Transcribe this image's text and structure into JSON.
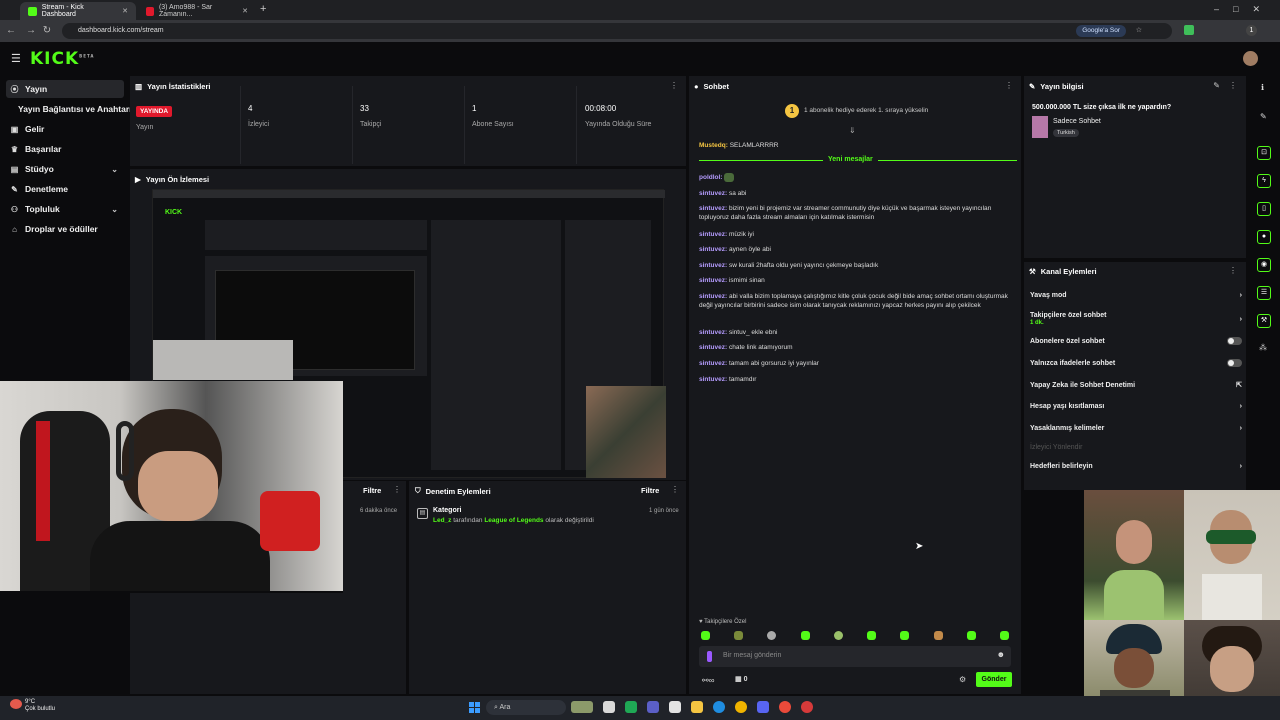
{
  "browser": {
    "tabs": [
      {
        "title": "Stream - Kick Dashboard",
        "active": true
      },
      {
        "title": "(3) Amo988 - Sar Zamanın...",
        "active": false
      }
    ],
    "url": "dashboard.kick.com/stream",
    "google_chip": "Google'a Sor"
  },
  "header": {
    "logo": "KICK",
    "logo_sup": "BETA"
  },
  "sidebar": {
    "items": [
      {
        "label": "Yayın",
        "icon": "broadcast-icon"
      },
      {
        "label": "Yayın Bağlantısı ve Anahtarı",
        "icon": ""
      },
      {
        "label": "Gelir",
        "icon": "wallet-icon"
      },
      {
        "label": "Başarılar",
        "icon": "trophy-icon"
      },
      {
        "label": "Stüdyo",
        "icon": "studio-icon"
      },
      {
        "label": "Denetleme",
        "icon": "wrench-icon"
      },
      {
        "label": "Topluluk",
        "icon": "users-icon"
      },
      {
        "label": "Droplar ve ödüller",
        "icon": "gift-icon"
      }
    ]
  },
  "stats": {
    "title": "Yayın İstatistikleri",
    "live_badge": "YAYINDA",
    "live_label": "Yayın",
    "viewers": "4",
    "viewers_label": "İzleyici",
    "followers": "33",
    "followers_label": "Takipçi",
    "subs": "1",
    "subs_label": "Abone Sayısı",
    "uptime": "00:08:00",
    "uptime_label": "Yayında Olduğu Süre"
  },
  "preview": {
    "title": "Yayın Ön İzlemesi"
  },
  "left_bottom": {
    "filter": "Filtre",
    "time": "6 dakika önce"
  },
  "moderation": {
    "title": "Denetim Eylemleri",
    "filter": "Filtre",
    "entry_title": "Kategori",
    "entry_user": "Led_z",
    "entry_mid": " tarafından ",
    "entry_category": "League of Legends",
    "entry_end": " olarak değiştirildi",
    "entry_time": "1 gün önce"
  },
  "chat": {
    "title": "Sohbet",
    "gift_banner": "1 abonelik hediye ederek 1. sıraya yükselin",
    "pinned_user": "Mustedq:",
    "pinned_msg": "SELAMLARRRR",
    "new_messages": "Yeni mesajlar",
    "messages": [
      {
        "user": "poldlol:",
        "text": ""
      },
      {
        "user": "sintuvez:",
        "text": "sa abi"
      },
      {
        "user": "sintuvez:",
        "text": "bizim yeni bi projemiz var streamer communutiy diye küçük ve başarmak isteyen yayıncıları topluyoruz daha fazla stream almaları için katılmak istermisin"
      },
      {
        "user": "sintuvez:",
        "text": "müzik iyi"
      },
      {
        "user": "sintuvez:",
        "text": "aynen öyle abi"
      },
      {
        "user": "sintuvez:",
        "text": "sw kurali 2hafta oldu yeni yayıncı çekmeye başladık"
      },
      {
        "user": "sintuvez:",
        "text": "ismimi sinan"
      },
      {
        "user": "sintuvez:",
        "text": "abi valla bizim toplamaya çalıştığımız kitle çoluk çocuk değil bide amaç sohbet ortamı oluşturmak değil yayıncılar birbirini sadece isim olarak tanıycak reklamınızı yapcaz herkes payını alıp çekilcek"
      },
      {
        "user": "sintuvez:",
        "text": "sintuv_ ekle ebni"
      },
      {
        "user": "sintuvez:",
        "text": "chate link atamıyorum"
      },
      {
        "user": "sintuvez:",
        "text": "tamam abi gorsuruz iyi yayınlar"
      },
      {
        "user": "sintuvez:",
        "text": "tamamdır"
      }
    ],
    "followers_only": "Takipçilere Özel",
    "input_placeholder": "Bir mesaj gönderin",
    "send": "Gönder",
    "points": "0"
  },
  "stream_info": {
    "title": "Yayın bilgisi",
    "stream_title": "500.000.000 TL size çıksa ilk ne yapardın?",
    "category": "Sadece Sohbet",
    "language": "Turkish"
  },
  "channel_actions": {
    "title": "Kanal Eylemleri",
    "items": [
      {
        "label": "Yavaş mod",
        "control": "arrow"
      },
      {
        "label": "Takipçilere özel sohbet",
        "sub": "1 dk.",
        "control": "arrow"
      },
      {
        "label": "Abonelere özel sohbet",
        "control": "toggle"
      },
      {
        "label": "Yalnızca ifadelerle sohbet",
        "control": "toggle"
      },
      {
        "label": "Yapay Zeka ile Sohbet Denetimi",
        "control": "external"
      },
      {
        "label": "Hesap yaşı kısıtlaması",
        "control": "arrow"
      },
      {
        "label": "Yasaklanmış kelimeler",
        "control": "arrow"
      },
      {
        "label": "İzleyici Yönlendir",
        "control": "none",
        "disabled": true
      },
      {
        "label": "Hedefleri belirleyin",
        "control": "arrow"
      }
    ]
  },
  "taskbar": {
    "search": "Ara",
    "weather_temp": "9°C",
    "weather_desc": "Çok bulutlu"
  }
}
